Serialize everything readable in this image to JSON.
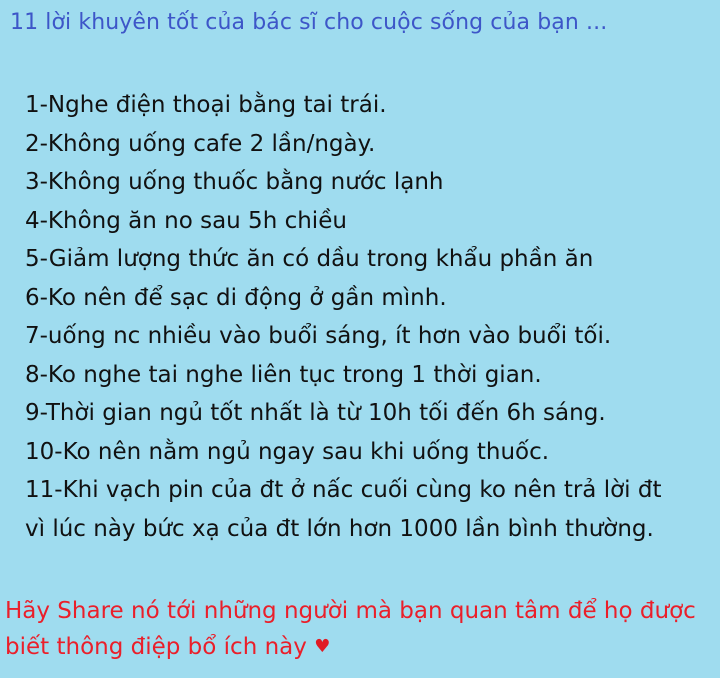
{
  "title": "11 lời khuyên tốt của bác sĩ cho cuộc sống của bạn ...",
  "tips": [
    "1-Nghe điện thoại bằng tai trái.",
    "2-Không uống cafe 2 lần/ngày.",
    "3-Không uống thuốc bằng nước lạnh",
    "4-Không ăn no sau 5h chiều",
    "5-Giảm lượng thức ăn có dầu trong khẩu phần ăn",
    "6-Ko nên để sạc di động ở gần mình.",
    "7-uống nc nhiều vào buổi sáng, ít hơn vào buổi tối.",
    "8-Ko nghe tai nghe liên tục trong 1 thời gian.",
    "9-Thời gian ngủ tốt nhất là từ 10h tối đến 6h sáng.",
    "10-Ko nên nằm ngủ ngay sau khi uống thuốc.",
    "11-Khi vạch pin của đt ở nấc cuối cùng ko nên trả lời đt vì lúc này bức xạ của đt lớn hơn 1000 lần bình thường."
  ],
  "footer": "Hãy Share nó tới những người mà bạn quan tâm để họ được biết thông điệp bổ ích này",
  "heart_icon": "♥",
  "colors": {
    "background": "#9fdcef",
    "title": "#3d56c8",
    "body_text": "#111111",
    "footer": "#ea1f2a",
    "heart": "#e01b24"
  }
}
